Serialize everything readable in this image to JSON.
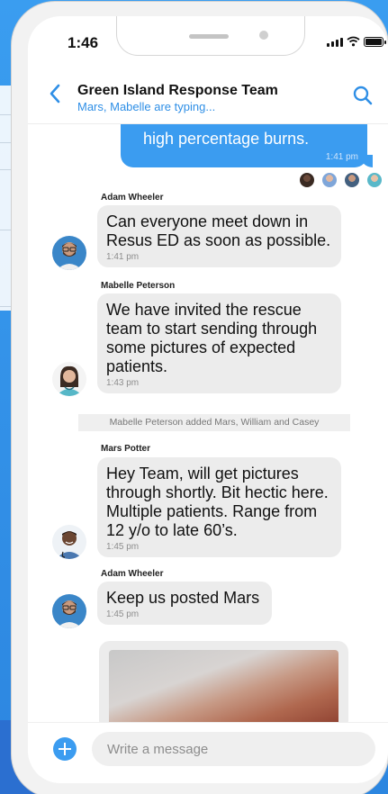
{
  "status": {
    "time": "1:46"
  },
  "header": {
    "title": "Green Island Response Team",
    "subtitle": "Mars, Mabelle are typing..."
  },
  "messages": {
    "outgoing": {
      "text": "high percentage burns.",
      "time": "1:41 pm"
    },
    "adam1": {
      "sender": "Adam Wheeler",
      "text": "Can everyone meet down in Resus ED as soon as possible.",
      "time": "1:41 pm"
    },
    "mabelle1": {
      "sender": "Mabelle Peterson",
      "text": "We have invited the rescue team to start sending through some pictures of expected patients.",
      "time": "1:43 pm"
    },
    "system": "Mabelle Peterson added Mars, William and Casey",
    "mars1": {
      "sender": "Mars Potter",
      "text": "Hey Team, will get pictures through shortly. Bit hectic here. Multiple patients. Range from 12 y/o to late 60’s.",
      "time": "1:45 pm"
    },
    "adam2": {
      "sender": "Adam Wheeler",
      "text": "Keep us posted Mars",
      "time": "1:45 pm"
    }
  },
  "composer": {
    "placeholder": "Write a message"
  },
  "icons": {
    "back": "chevron-left-icon",
    "search": "search-icon",
    "add": "plus-circle-icon"
  },
  "colors": {
    "accent": "#3b9cf0",
    "incoming_bubble": "#ececec",
    "background": "#2f8fe6"
  }
}
